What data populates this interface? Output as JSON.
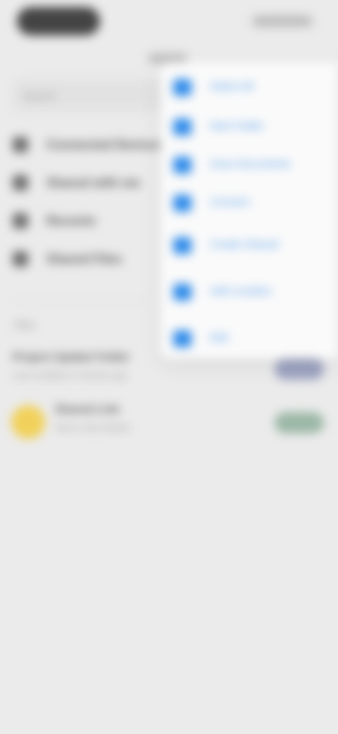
{
  "status_bar": {},
  "search": {
    "placeholder": "Search"
  },
  "left_menu": [
    {
      "label": "Connected Devices",
      "icon": "devices-icon"
    },
    {
      "label": "Shared with me",
      "icon": "shared-icon"
    },
    {
      "label": "Recents",
      "icon": "recents-icon"
    },
    {
      "label": "Shared Files",
      "icon": "shared-files-icon"
    }
  ],
  "section": {
    "label": "Files"
  },
  "list": [
    {
      "title": "Project Update Folder",
      "subtitle": "Last modified 2 minutes ago",
      "action": "Open"
    },
    {
      "title": "Shared Link",
      "subtitle": "Tap to view details",
      "action": "View"
    }
  ],
  "popup_menu": {
    "title": "Select",
    "items": [
      {
        "label": "Select All",
        "icon": "select-all-icon"
      },
      {
        "label": "New Folder",
        "icon": "folder-icon"
      },
      {
        "label": "Scan Documents",
        "icon": "scan-icon"
      },
      {
        "label": "Connect",
        "icon": "connect-icon"
      },
      {
        "label": "Create Shared",
        "icon": "share-icon"
      },
      {
        "label": "Add Location",
        "icon": "location-icon"
      },
      {
        "label": "Edit",
        "icon": "edit-icon"
      }
    ]
  },
  "colors": {
    "background": "#ebebeb",
    "accent": "#2f8bea",
    "avatar": "#f1d15a"
  }
}
